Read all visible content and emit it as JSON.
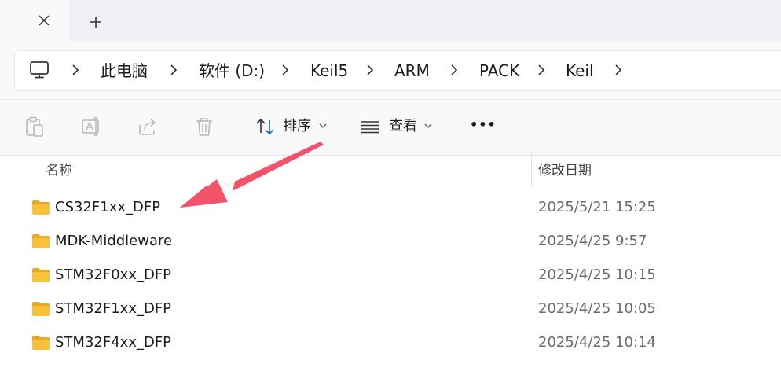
{
  "tabs": {
    "close_icon": "close-icon",
    "new_tab_icon": "plus-icon"
  },
  "breadcrumb": [
    "此电脑",
    "软件 (D:)",
    "Keil5",
    "ARM",
    "PACK",
    "Keil"
  ],
  "toolbar": {
    "sort_label": "排序",
    "view_label": "查看",
    "more_label": "•••"
  },
  "columns": {
    "name": "名称",
    "date": "修改日期"
  },
  "files": [
    {
      "name": "CS32F1xx_DFP",
      "date": "2025/5/21 15:25"
    },
    {
      "name": "MDK-Middleware",
      "date": "2025/4/25 9:57"
    },
    {
      "name": "STM32F0xx_DFP",
      "date": "2025/4/25 10:15"
    },
    {
      "name": "STM32F1xx_DFP",
      "date": "2025/4/25 10:05"
    },
    {
      "name": "STM32F4xx_DFP",
      "date": "2025/4/25 10:14"
    }
  ],
  "colors": {
    "annotation_arrow": "#f2536a",
    "folder": "#f8c13a"
  }
}
